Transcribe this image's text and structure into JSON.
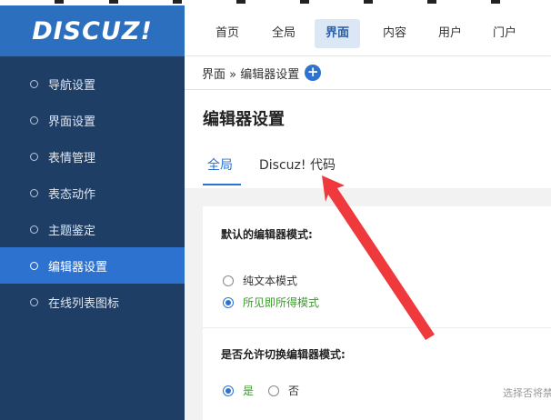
{
  "logo": {
    "text": "DISCUZ!"
  },
  "topnav": {
    "items": [
      {
        "label": "首页"
      },
      {
        "label": "全局"
      },
      {
        "label": "界面"
      },
      {
        "label": "内容"
      },
      {
        "label": "用户"
      },
      {
        "label": "门户"
      }
    ],
    "active": "界面"
  },
  "sidebar": {
    "items": [
      {
        "label": "导航设置"
      },
      {
        "label": "界面设置"
      },
      {
        "label": "表情管理"
      },
      {
        "label": "表态动作"
      },
      {
        "label": "主题鉴定"
      },
      {
        "label": "编辑器设置"
      },
      {
        "label": "在线列表图标"
      }
    ],
    "active": "编辑器设置"
  },
  "breadcrumb": {
    "text": "界面 » 编辑器设置",
    "plus": "+"
  },
  "page": {
    "title": "编辑器设置",
    "tabs": [
      {
        "label": "全局"
      },
      {
        "label": "Discuz! 代码"
      }
    ],
    "active_tab": "全局"
  },
  "settings": {
    "default_mode": {
      "label": "默认的编辑器模式:",
      "options": [
        {
          "label": "纯文本模式",
          "selected": false
        },
        {
          "label": "所见即所得模式",
          "selected": true
        }
      ]
    },
    "allow_switch": {
      "label": "是否允许切换编辑器模式:",
      "options": [
        {
          "label": "是",
          "selected": true
        },
        {
          "label": "否",
          "selected": false
        }
      ],
      "hint": "选择否将禁"
    }
  },
  "colors": {
    "sidebar_bg": "#1e3e66",
    "logo_bg": "#2d6fbf",
    "accent": "#2d72cf",
    "selected_text": "#3a9b2a",
    "annotation_arrow": "#f0393c"
  }
}
